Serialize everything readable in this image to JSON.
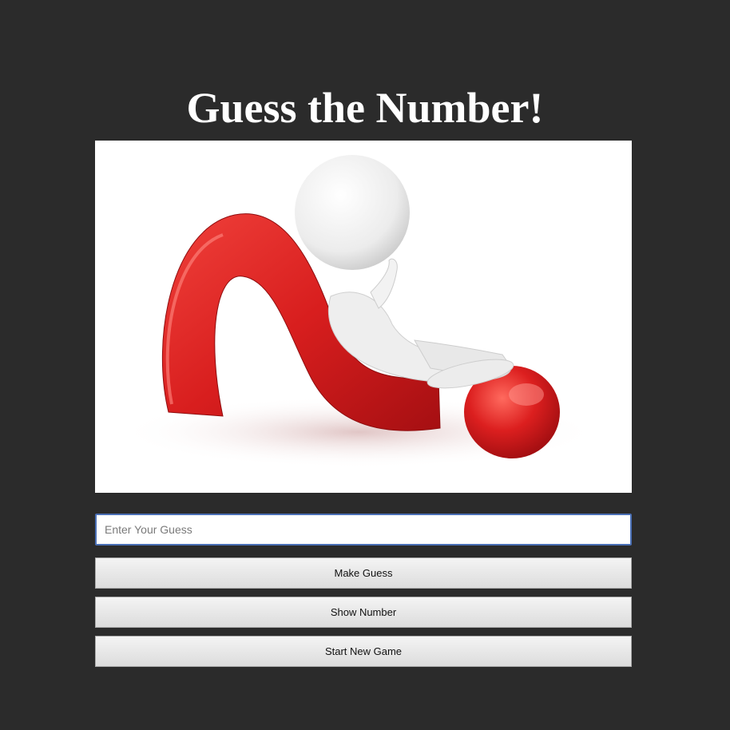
{
  "page": {
    "title": "Guess the Number!"
  },
  "hero": {
    "image": "question-mark-figure-illustration"
  },
  "guess_input": {
    "value": "",
    "placeholder": "Enter Your Guess"
  },
  "buttons": {
    "make_guess": "Make Guess",
    "show_number": "Show Number",
    "start_new_game": "Start New Game"
  },
  "colors": {
    "background": "#2b2b2b",
    "title": "#ffffff",
    "accent_red": "#d81e1e",
    "input_border": "#4a6fb5"
  }
}
